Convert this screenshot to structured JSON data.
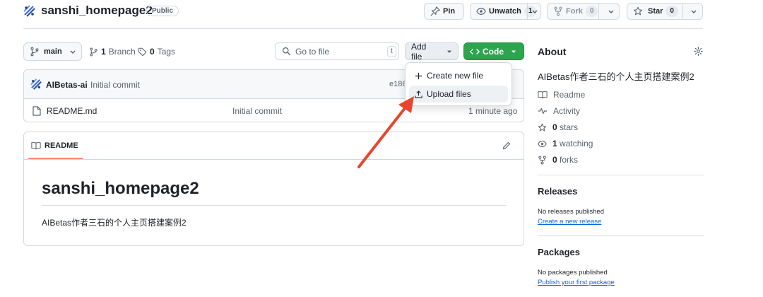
{
  "repo": {
    "name": "sanshi_homepage2",
    "visibility": "Public"
  },
  "actions": {
    "pin": "Pin",
    "unwatch": "Unwatch",
    "watch_count": "1",
    "fork": "Fork",
    "fork_count": "0",
    "star": "Star",
    "star_count": "0"
  },
  "toolbar": {
    "branch": "main",
    "branches_count": "1",
    "branches_label": "Branch",
    "tags_count": "0",
    "tags_label": "Tags",
    "search_placeholder": "Go to file",
    "search_shortcut": "t",
    "add_file": "Add file",
    "code": "Code"
  },
  "dropdown": {
    "items": [
      {
        "label": "Create new file"
      },
      {
        "label": "Upload files"
      }
    ]
  },
  "commit": {
    "author": "AIBetas-ai",
    "message": "Initial commit",
    "hash_partial": "e186"
  },
  "files": [
    {
      "name": "README.md",
      "message": "Initial commit",
      "time": "1 minute ago"
    }
  ],
  "readme": {
    "tab": "README",
    "heading": "sanshi_homepage2",
    "body": "AIBetas作者三石的个人主页搭建案例2"
  },
  "about": {
    "title": "About",
    "description": "AIBetas作者三石的个人主页搭建案例2",
    "readme": "Readme",
    "activity": "Activity",
    "stars_count": "0",
    "stars_label": "stars",
    "watching_count": "1",
    "watching_label": "watching",
    "forks_count": "0",
    "forks_label": "forks"
  },
  "releases": {
    "title": "Releases",
    "empty": "No releases published",
    "link": "Create a new release"
  },
  "packages": {
    "title": "Packages",
    "empty": "No packages published",
    "link": "Publish your first package"
  },
  "colors": {
    "accent_green": "#2da44e",
    "link_blue": "#0969da",
    "arrow_red": "#e8452e",
    "readme_underline": "#fd8c73"
  }
}
